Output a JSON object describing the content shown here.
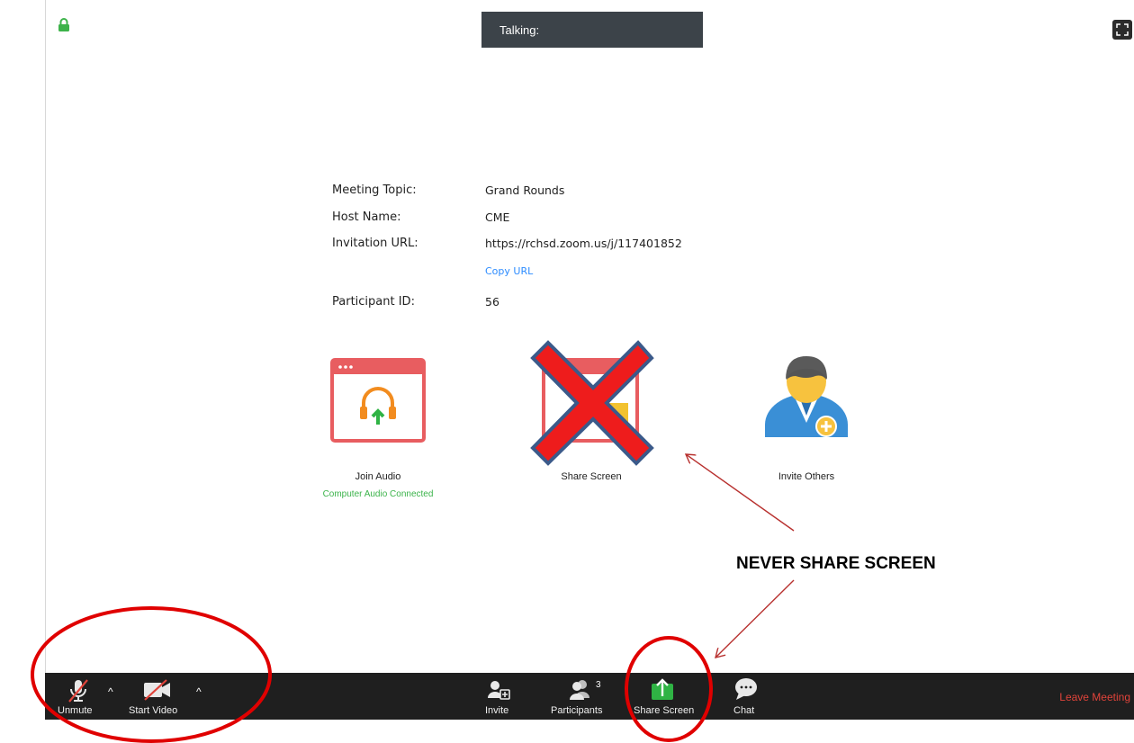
{
  "talking_bar": {
    "label": "Talking:"
  },
  "meeting_info": {
    "topic_label": "Meeting Topic:",
    "topic_value": "Grand Rounds",
    "host_label": "Host Name:",
    "host_value": "CME",
    "url_label": "Invitation URL:",
    "url_value": "https://rchsd.zoom.us/j/117401852",
    "copy_url": "Copy URL",
    "participant_label": "Participant ID:",
    "participant_value": "56"
  },
  "actions": {
    "join_audio": "Join Audio",
    "join_audio_status": "Computer Audio Connected",
    "share_screen": "Share Screen",
    "invite_others": "Invite Others"
  },
  "annotation": {
    "text": "NEVER SHARE SCREEN"
  },
  "toolbar": {
    "unmute": "Unmute",
    "start_video": "Start Video",
    "invite": "Invite",
    "participants": "Participants",
    "participants_count": "3",
    "share_screen": "Share Screen",
    "chat": "Chat",
    "leave_meeting": "Leave Meeting"
  },
  "icons": {
    "lock": "lock-icon",
    "fullscreen": "fullscreen-icon",
    "mic_muted": "mic-muted-icon",
    "video_off": "video-off-icon",
    "invite": "invite-icon",
    "participants": "participants-icon",
    "share": "share-screen-icon",
    "chat": "chat-icon"
  },
  "colors": {
    "toolbar_bg": "#1f1f1f",
    "talking_bg": "#3c4349",
    "link": "#2d8cff",
    "status_green": "#3bb34a",
    "share_green": "#2fb344",
    "leave_red": "#e0433a",
    "annotation_red": "#e00000",
    "x_red": "#ee1c1c",
    "x_outline": "#3b5a8a"
  }
}
